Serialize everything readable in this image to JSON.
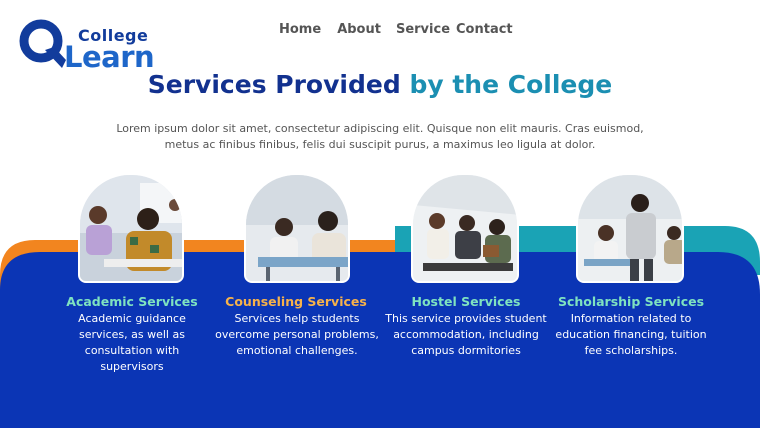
{
  "logo": {
    "college": "College",
    "learn": "Learn",
    "colors": {
      "q": "#123c9c",
      "college": "#123c9c",
      "learn": "#1e66c9"
    }
  },
  "nav": {
    "items": [
      "Home",
      "About",
      "Service",
      "Contact"
    ]
  },
  "heading": {
    "part1": "Services Provided",
    "part2": " by the College",
    "colors": {
      "part1": "#12318f",
      "part2": "#1b8fb2"
    }
  },
  "intro": "Lorem ipsum dolor sit amet, consectetur adipiscing elit. Quisque non elit mauris. Cras euismod, metus ac finibus finibus, felis dui suscipit purus, a maximus leo ligula at dolor.",
  "colors": {
    "panel": "#0b35b5",
    "orange": "#f2851f",
    "teal": "#1aa3b5"
  },
  "services": [
    {
      "title": "Academic Services",
      "title_color": "#7fe3c0",
      "description": "Academic guidance services, as well as consultation with supervisors",
      "image": "students-writing-exam-photo"
    },
    {
      "title": "Counseling Services",
      "title_color": "#f7b24a",
      "description": "Services help students overcome personal problems, emotional challenges.",
      "image": "students-talking-at-table-photo"
    },
    {
      "title": "Hostel Services",
      "title_color": "#7fe3c0",
      "description": "This service provides student accommodation, including campus dormitories",
      "image": "students-in-lounge-photo"
    },
    {
      "title": "Scholarship Services",
      "title_color": "#7fe3c0",
      "description": "Information related to education financing, tuition fee scholarships.",
      "image": "teacher-helping-students-photo"
    }
  ]
}
